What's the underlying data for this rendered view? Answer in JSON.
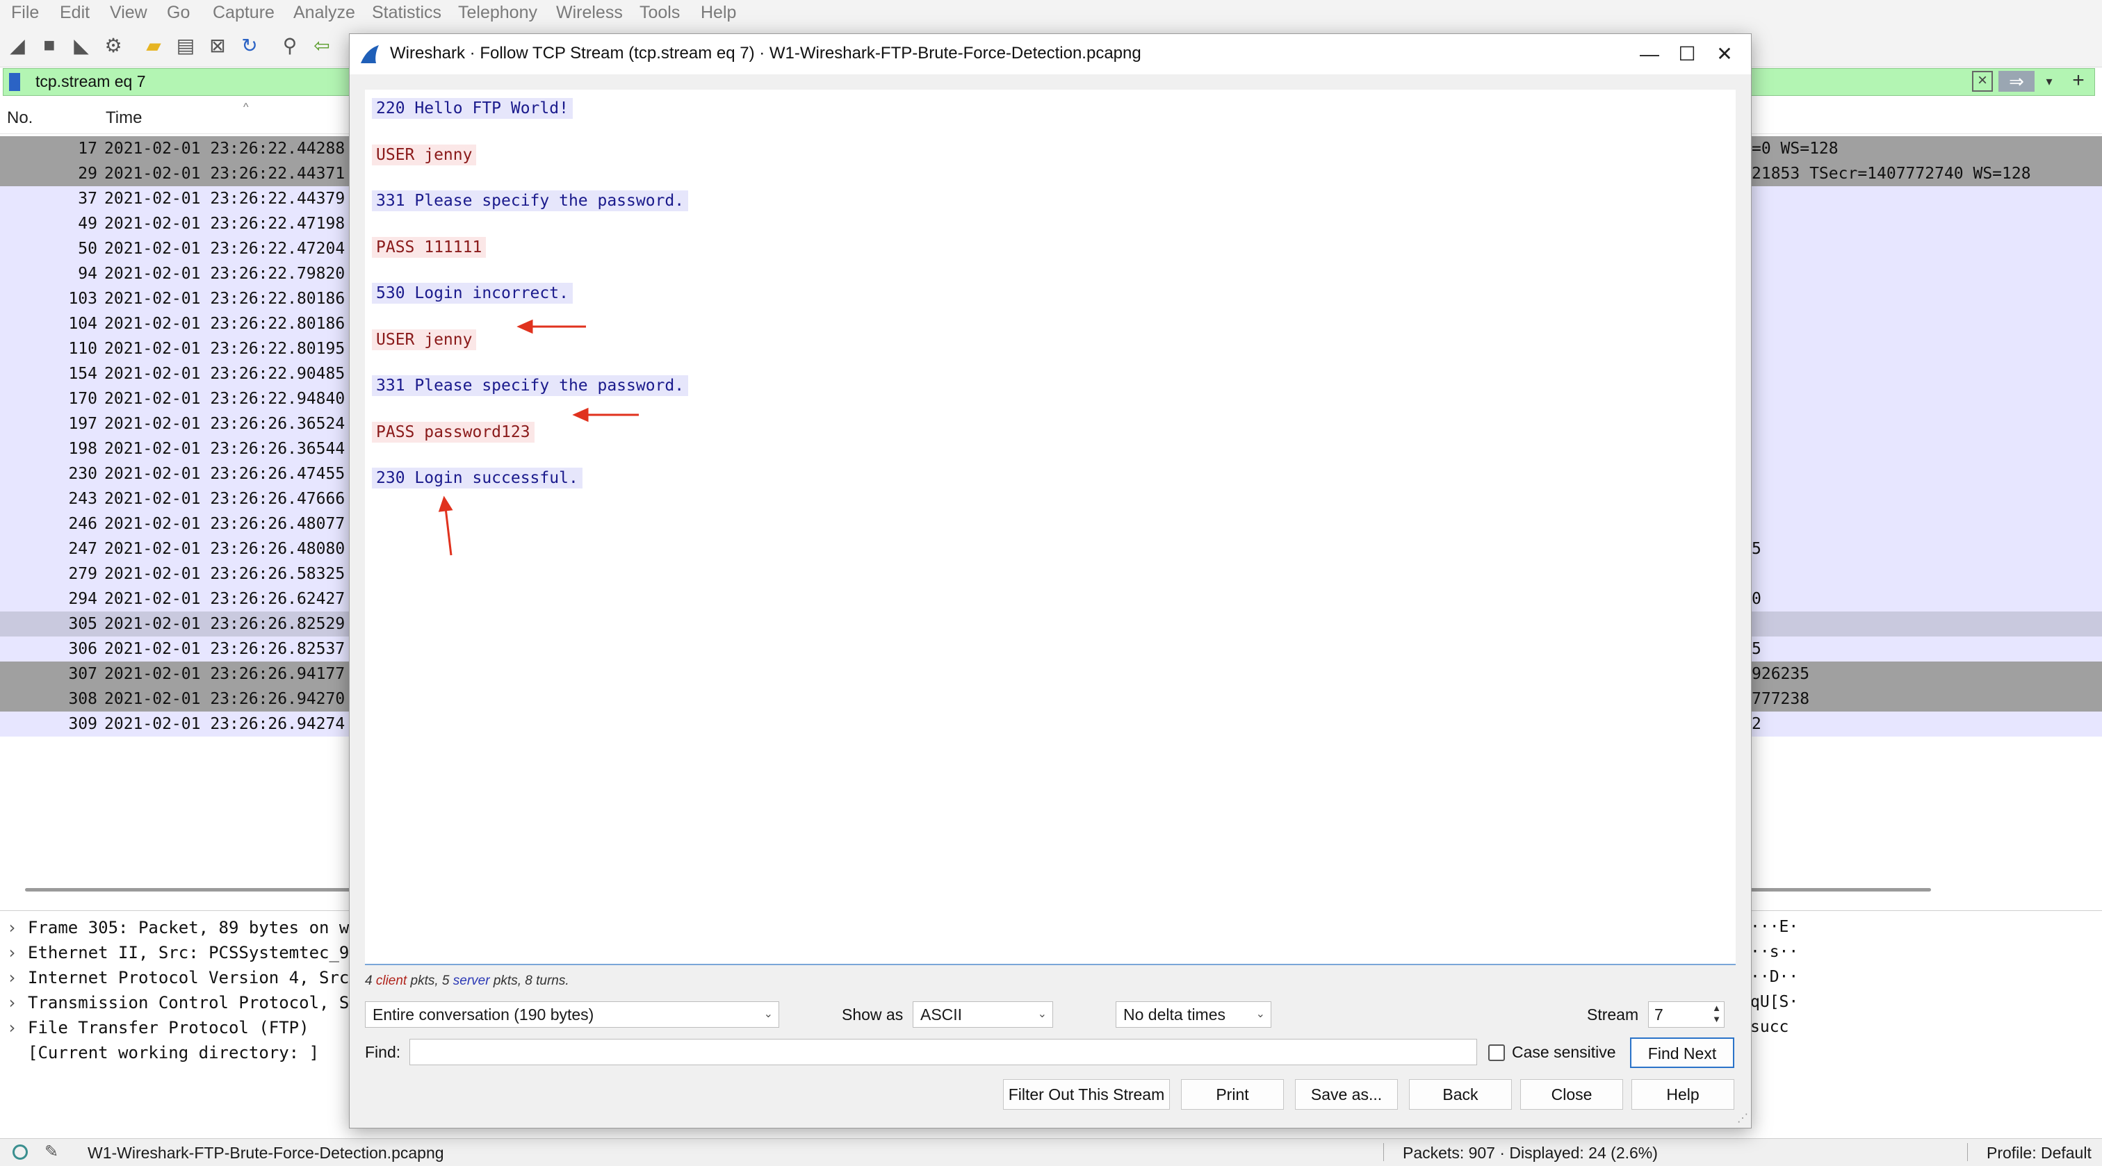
{
  "menu": [
    "File",
    "Edit",
    "View",
    "Go",
    "Capture",
    "Analyze",
    "Statistics",
    "Telephony",
    "Wireless",
    "Tools",
    "Help"
  ],
  "filter": {
    "text": "tcp.stream eq 7"
  },
  "columns": {
    "no": "No.",
    "time": "Time"
  },
  "packets": [
    {
      "no": "17",
      "time": "2021-02-01 23:26:22.44288",
      "info": "=0 WS=128",
      "style": "dark"
    },
    {
      "no": "29",
      "time": "2021-02-01 23:26:22.44371",
      "info": "21853 TSecr=1407772740 WS=128",
      "style": "dark"
    },
    {
      "no": "37",
      "time": "2021-02-01 23:26:22.44379",
      "info": "",
      "style": "light"
    },
    {
      "no": "49",
      "time": "2021-02-01 23:26:22.47198",
      "info": "",
      "style": "light"
    },
    {
      "no": "50",
      "time": "2021-02-01 23:26:22.47204",
      "info": "",
      "style": "light"
    },
    {
      "no": "94",
      "time": "2021-02-01 23:26:22.79820",
      "info": "",
      "style": "light"
    },
    {
      "no": "103",
      "time": "2021-02-01 23:26:22.80186",
      "info": "",
      "style": "light"
    },
    {
      "no": "104",
      "time": "2021-02-01 23:26:22.80186",
      "info": "",
      "style": "light"
    },
    {
      "no": "110",
      "time": "2021-02-01 23:26:22.80195",
      "info": "",
      "style": "light"
    },
    {
      "no": "154",
      "time": "2021-02-01 23:26:22.90485",
      "info": "",
      "style": "light"
    },
    {
      "no": "170",
      "time": "2021-02-01 23:26:22.94840",
      "info": "",
      "style": "light"
    },
    {
      "no": "197",
      "time": "2021-02-01 23:26:26.36524",
      "info": "",
      "style": "light"
    },
    {
      "no": "198",
      "time": "2021-02-01 23:26:26.36544",
      "info": "",
      "style": "light"
    },
    {
      "no": "230",
      "time": "2021-02-01 23:26:26.47455",
      "info": "",
      "style": "light"
    },
    {
      "no": "243",
      "time": "2021-02-01 23:26:26.47666",
      "info": "",
      "style": "light"
    },
    {
      "no": "246",
      "time": "2021-02-01 23:26:26.48077",
      "info": "",
      "style": "light"
    },
    {
      "no": "247",
      "time": "2021-02-01 23:26:26.48080",
      "info": "5",
      "style": "light"
    },
    {
      "no": "279",
      "time": "2021-02-01 23:26:26.58325",
      "info": "",
      "style": "light"
    },
    {
      "no": "294",
      "time": "2021-02-01 23:26:26.62427",
      "info": "0",
      "style": "light"
    },
    {
      "no": "305",
      "time": "2021-02-01 23:26:26.82529",
      "info": "",
      "style": "sel"
    },
    {
      "no": "306",
      "time": "2021-02-01 23:26:26.82537",
      "info": "5",
      "style": "light"
    },
    {
      "no": "307",
      "time": "2021-02-01 23:26:26.94177",
      "info": "926235",
      "style": "dark"
    },
    {
      "no": "308",
      "time": "2021-02-01 23:26:26.94270",
      "info": "777238",
      "style": "dark"
    },
    {
      "no": "309",
      "time": "2021-02-01 23:26:26.94274",
      "info": "2",
      "style": "light"
    }
  ],
  "details": [
    "Frame 305: Packet, 89 bytes on w",
    "Ethernet II, Src: PCSSystemtec_9",
    "Internet Protocol Version 4, Src",
    "Transmission Control Protocol, S",
    "File Transfer Protocol (FTP)",
    "[Current working directory: ]"
  ],
  "hex": [
    "···E·",
    "··s··",
    "··D··",
    "qU[S·",
    " succ"
  ],
  "status": {
    "file": "W1-Wireshark-FTP-Brute-Force-Detection.pcapng",
    "packets": "Packets: 907 · Displayed: 24 (2.6%)",
    "profile": "Profile: Default"
  },
  "dialog": {
    "title": "Wireshark · Follow TCP Stream (tcp.stream eq 7) · W1-Wireshark-FTP-Brute-Force-Detection.pcapng",
    "stream": [
      {
        "text": "220 Hello FTP World!",
        "role": "server"
      },
      {
        "text": "USER jenny",
        "role": "client"
      },
      {
        "text": "331 Please specify the password.",
        "role": "server"
      },
      {
        "text": "PASS 111111",
        "role": "client"
      },
      {
        "text": "530 Login incorrect.",
        "role": "server"
      },
      {
        "text": "USER jenny",
        "role": "client"
      },
      {
        "text": "331 Please specify the password.",
        "role": "server"
      },
      {
        "text": "PASS password123",
        "role": "client"
      },
      {
        "text": "230 Login successful.",
        "role": "server"
      }
    ],
    "summary": {
      "client_count": "4",
      "client_word": "client",
      "mid": "pkts,",
      "server_count": "5",
      "server_word": "server",
      "tail": "pkts, 8 turns."
    },
    "conversation": "Entire conversation (190 bytes)",
    "show_as_label": "Show as",
    "show_as": "ASCII",
    "delta": "No delta times",
    "stream_label": "Stream",
    "stream_value": "7",
    "find_label": "Find:",
    "case_label": "Case sensitive",
    "find_next": "Find Next",
    "buttons": [
      "Filter Out This Stream",
      "Print",
      "Save as...",
      "Back",
      "Close",
      "Help"
    ]
  },
  "colors": {
    "server_text": "#1a1a8c",
    "server_bg": "#e6e6fb",
    "client_text": "#8a1a1a",
    "client_bg": "#fbe7e7",
    "annotation": "#e0321e",
    "filter_ok": "#b3f5b3"
  }
}
